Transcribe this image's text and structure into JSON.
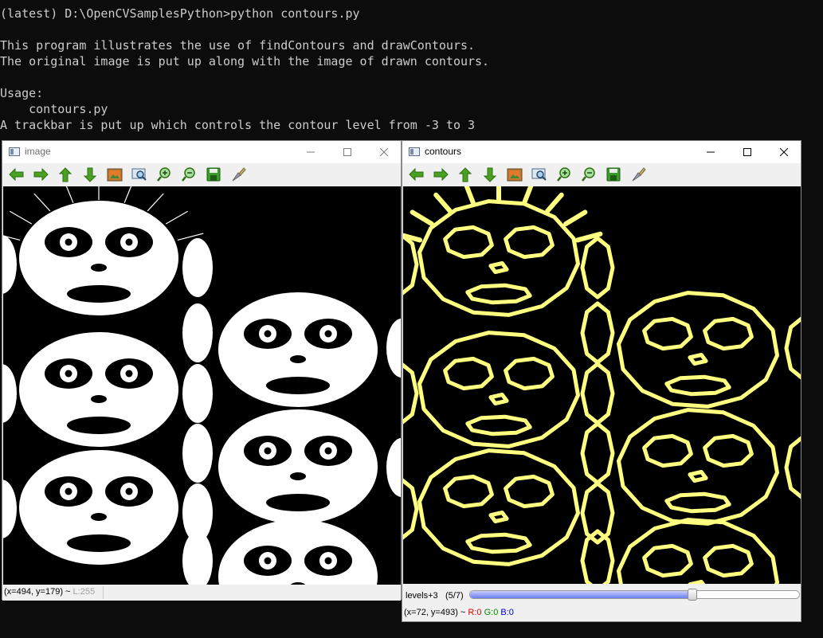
{
  "console": {
    "lines": [
      "(latest) D:\\OpenCVSamplesPython>python contours.py",
      "",
      "This program illustrates the use of findContours and drawContours.",
      "The original image is put up along with the image of drawn contours.",
      "",
      "Usage:",
      "    contours.py",
      "A trackbar is put up which controls the contour level from -3 to 3"
    ]
  },
  "toolbar_tools": [
    "arrow-left-icon",
    "arrow-right-icon",
    "arrow-up-icon",
    "arrow-down-icon",
    "image-icon",
    "zoom-fit-icon",
    "zoom-in-icon",
    "zoom-out-icon",
    "save-icon",
    "properties-icon"
  ],
  "image_window": {
    "title": "image",
    "status": {
      "coords": "(x=494, y=179) ~ ",
      "value": "L:255"
    }
  },
  "contours_window": {
    "title": "contours",
    "trackbar": {
      "label": "levels+3",
      "value_text": "(5/7)",
      "value": 5,
      "max": 7
    },
    "status": {
      "coords": "(x=72, y=493) ~ ",
      "r": "R:0",
      "g": "G:0",
      "b": "B:0"
    }
  },
  "colors": {
    "contour": "#ffff80",
    "image_fg": "#ffffff",
    "canvas_bg": "#000000",
    "trackbar_fill": "#6a7ff0"
  }
}
